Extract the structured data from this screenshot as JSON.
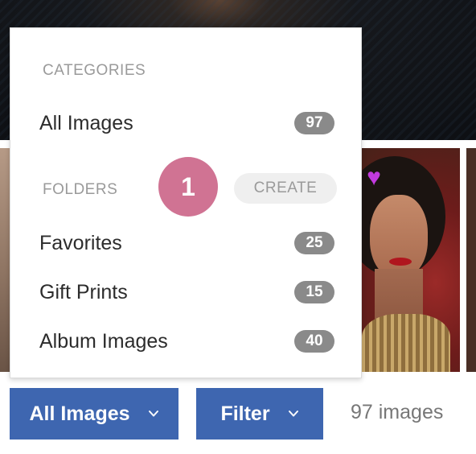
{
  "menu": {
    "categories_heading": "CATEGORIES",
    "categories": [
      {
        "label": "All Images",
        "count": "97"
      }
    ],
    "folders_heading": "FOLDERS",
    "create_label": "CREATE",
    "folders": [
      {
        "label": "Favorites",
        "count": "25"
      },
      {
        "label": "Gift Prints",
        "count": "15"
      },
      {
        "label": "Album Images",
        "count": "40"
      }
    ]
  },
  "step_badge": "1",
  "toolbar": {
    "category_button": "All Images",
    "filter_button": "Filter",
    "image_count": "97 images"
  },
  "icons": {
    "favorite": "heart-icon",
    "dropdown": "chevron-down-icon"
  },
  "colors": {
    "accent": "#3e66b0",
    "step_badge": "#d07393",
    "heart": "#c23adf",
    "count_badge": "#8a8a8a"
  }
}
